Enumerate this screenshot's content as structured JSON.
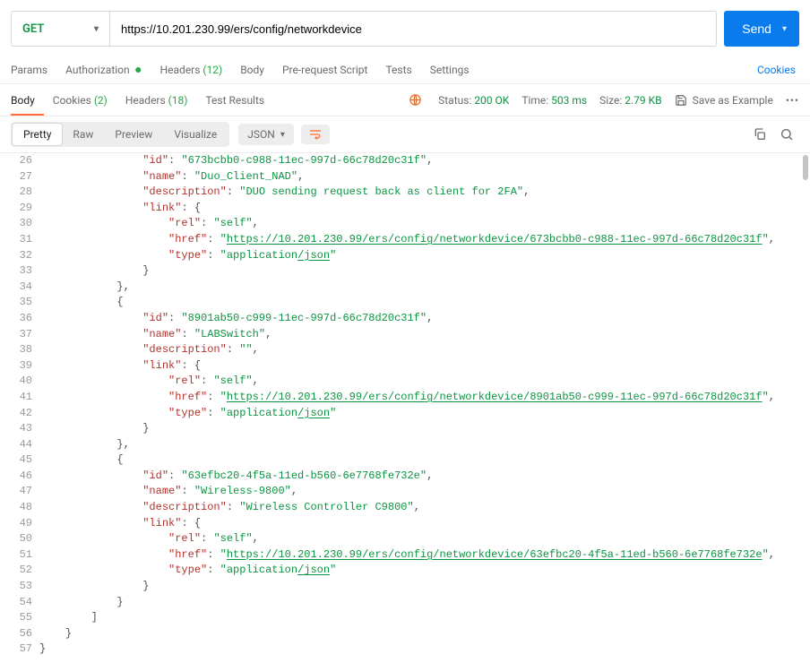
{
  "request": {
    "method": "GET",
    "url": "https://10.201.230.99/ers/config/networkdevice",
    "send_label": "Send"
  },
  "req_tabs": {
    "params": "Params",
    "authorization": "Authorization",
    "headers": "Headers",
    "headers_count": "(12)",
    "body": "Body",
    "prerequest": "Pre-request Script",
    "tests": "Tests",
    "settings": "Settings",
    "cookies": "Cookies"
  },
  "resp_tabs": {
    "body": "Body",
    "cookies": "Cookies",
    "cookies_count": "(2)",
    "headers": "Headers",
    "headers_count": "(18)",
    "test_results": "Test Results",
    "status_label": "Status:",
    "status_value": "200 OK",
    "time_label": "Time:",
    "time_value": "503 ms",
    "size_label": "Size:",
    "size_value": "2.79 KB",
    "save_example": "Save as Example"
  },
  "view_bar": {
    "pretty": "Pretty",
    "raw": "Raw",
    "preview": "Preview",
    "visualize": "Visualize",
    "format": "JSON"
  },
  "code_lines": {
    "l26": "                \"id\": \"673bcbb0-c988-11ec-997d-66c78d20c31f\",",
    "l27": "                \"name\": \"Duo_Client_NAD\",",
    "l28": "                \"description\": \"DUO sending request back as client for 2FA\",",
    "l29": "                \"link\": {",
    "l30": "                    \"rel\": \"self\",",
    "l31_pre": "                    \"href\": \"",
    "l31_url": "https://10.201.230.99/ers/config/networkdevice/673bcbb0-c988-11ec-997d-66c78d20c31f",
    "l31_post": "\",",
    "l32": "                    \"type\": \"application/json\"",
    "l33": "                }",
    "l34": "            },",
    "l35": "            {",
    "l36": "                \"id\": \"8901ab50-c999-11ec-997d-66c78d20c31f\",",
    "l37": "                \"name\": \"LABSwitch\",",
    "l38": "                \"description\": \"\",",
    "l39": "                \"link\": {",
    "l40": "                    \"rel\": \"self\",",
    "l41_pre": "                    \"href\": \"",
    "l41_url": "https://10.201.230.99/ers/config/networkdevice/8901ab50-c999-11ec-997d-66c78d20c31f",
    "l41_post": "\",",
    "l42": "                    \"type\": \"application/json\"",
    "l43": "                }",
    "l44": "            },",
    "l45": "            {",
    "l46": "                \"id\": \"63efbc20-4f5a-11ed-b560-6e7768fe732e\",",
    "l47": "                \"name\": \"Wireless-9800\",",
    "l48": "                \"description\": \"Wireless Controller C9800\",",
    "l49": "                \"link\": {",
    "l50": "                    \"rel\": \"self\",",
    "l51_pre": "                    \"href\": \"",
    "l51_url": "https://10.201.230.99/ers/config/networkdevice/63efbc20-4f5a-11ed-b560-6e7768fe732e",
    "l51_post": "\",",
    "l52": "                    \"type\": \"application/json\"",
    "l53": "                }",
    "l54": "            }",
    "l55": "        ]",
    "l56": "    }",
    "l57": "}"
  },
  "line_numbers": [
    "26",
    "27",
    "28",
    "29",
    "30",
    "31",
    "32",
    "33",
    "34",
    "35",
    "36",
    "37",
    "38",
    "39",
    "40",
    "41",
    "42",
    "43",
    "44",
    "45",
    "46",
    "47",
    "48",
    "49",
    "50",
    "51",
    "52",
    "53",
    "54",
    "55",
    "56",
    "57"
  ]
}
